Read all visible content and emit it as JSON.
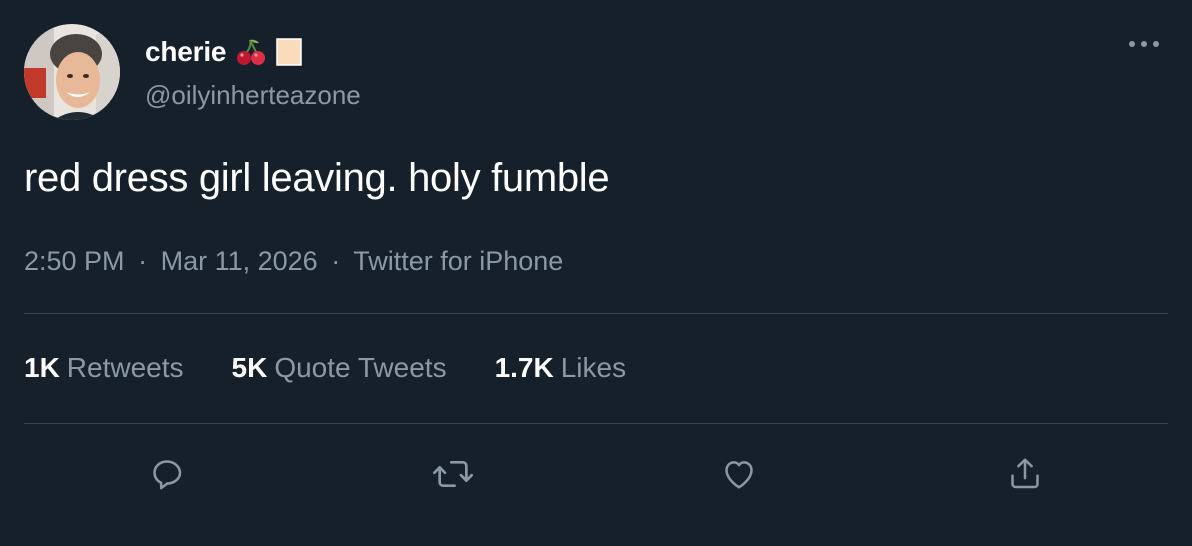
{
  "tweet": {
    "display_name": "cherie",
    "name_emojis": [
      "cherries-emoji",
      "light-skin-tone-emoji"
    ],
    "handle": "@oilyinherteazone",
    "text": "red dress girl leaving. holy fumble",
    "time": "2:50 PM",
    "date": "Mar 11, 2026",
    "source": "Twitter for iPhone",
    "separator": "·"
  },
  "stats": [
    {
      "count": "1K",
      "label": "Retweets"
    },
    {
      "count": "5K",
      "label": "Quote Tweets"
    },
    {
      "count": "1.7K",
      "label": "Likes"
    }
  ],
  "actions": [
    "reply-icon",
    "retweet-icon",
    "like-icon",
    "share-icon"
  ],
  "colors": {
    "background": "#15202b",
    "primary_text": "#ffffff",
    "secondary_text": "#8b98a5",
    "divider": "#38444d"
  }
}
